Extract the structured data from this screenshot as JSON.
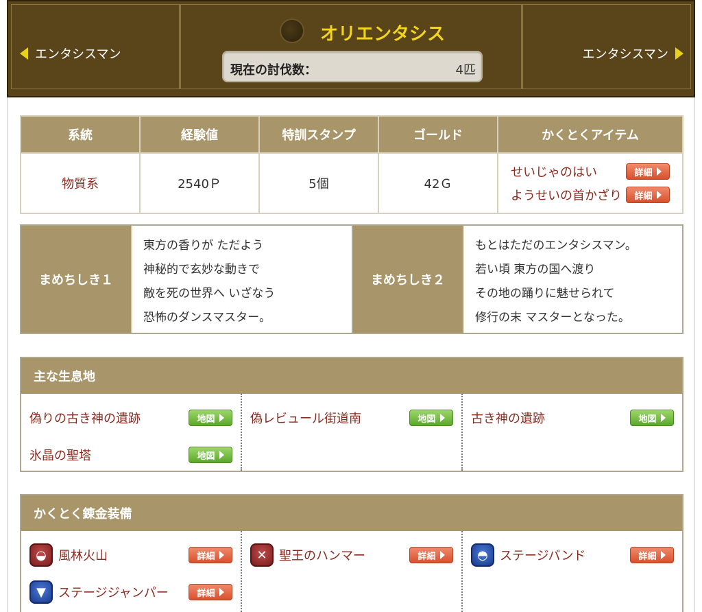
{
  "header": {
    "prev_label": "エンタシスマン",
    "next_label": "エンタシスマン",
    "monster_name": "オリエンタシス",
    "count_label": "現在の討伐数：",
    "count_value": "4匹"
  },
  "stats": {
    "headers": [
      "系統",
      "経験値",
      "特訓スタンプ",
      "ゴールド",
      "かくとくアイテム"
    ],
    "category": "物質系",
    "exp": "2540Ｐ",
    "stamps": "5個",
    "gold": "42Ｇ",
    "items": [
      "せいじゃのはい",
      "ようせいの首かざり"
    ],
    "detail_label": "詳細"
  },
  "trivia": {
    "label1": "まめちしき１",
    "text1": [
      "東方の香りが ただよう",
      "神秘的で玄妙な動きで",
      "敵を死の世界へ いざなう",
      "恐怖のダンスマスター。"
    ],
    "label2": "まめちしき２",
    "text2": [
      "もとはただのエンタシスマン。",
      "若い頃 東方の国へ渡り",
      "その地の踊りに魅せられて",
      "修行の末 マスターとなった。"
    ]
  },
  "habitat": {
    "title": "主な生息地",
    "map_label": "地図",
    "places": [
      "偽りの古き神の遺跡",
      "氷晶の聖塔",
      "偽レビュール街道南",
      "古き神の遺跡"
    ]
  },
  "equipment": {
    "title": "かくとく錬金装備",
    "detail_label": "詳細",
    "items": [
      "風林火山",
      "ステージジャンパー",
      "聖王のハンマー",
      "ステージバンド"
    ]
  },
  "colors": {
    "header_bg": "#5a4419",
    "title_gold": "#f2d51e",
    "table_head": "#a8966a",
    "link_red": "#8b2b20",
    "detail_btn": "#d8502e",
    "map_btn": "#5aa82a"
  }
}
